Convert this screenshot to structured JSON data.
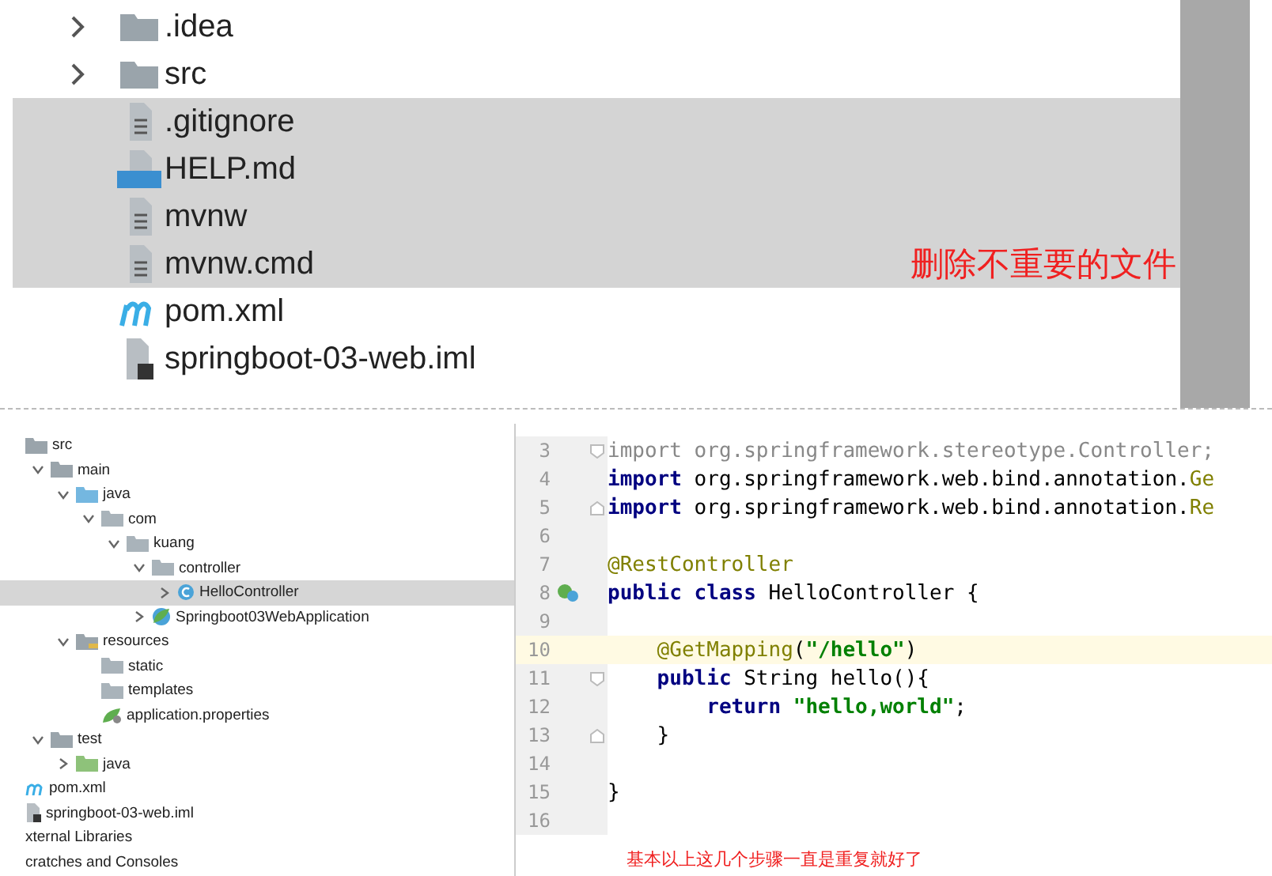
{
  "top_panel": {
    "files": [
      {
        "name": ".idea",
        "kind": "folder",
        "expanded": false,
        "selected": false
      },
      {
        "name": "src",
        "kind": "folder",
        "expanded": false,
        "selected": false
      },
      {
        "name": ".gitignore",
        "kind": "text-file",
        "selected": true
      },
      {
        "name": "HELP.md",
        "kind": "markdown",
        "selected": true
      },
      {
        "name": "mvnw",
        "kind": "text-file",
        "selected": true
      },
      {
        "name": "mvnw.cmd",
        "kind": "text-file",
        "selected": true
      },
      {
        "name": "pom.xml",
        "kind": "maven",
        "selected": false
      },
      {
        "name": "springboot-03-web.iml",
        "kind": "module-file",
        "selected": false
      }
    ],
    "note": "删除不重要的文件"
  },
  "project_tree": {
    "items": [
      {
        "name": "src",
        "kind": "folder",
        "selected": false,
        "children": [
          {
            "name": "main",
            "kind": "folder",
            "expanded": true,
            "selected": false,
            "children": [
              {
                "name": "java",
                "kind": "source-folder",
                "expanded": true,
                "selected": false,
                "children": [
                  {
                    "name": "com",
                    "kind": "package",
                    "expanded": true,
                    "selected": false,
                    "children": [
                      {
                        "name": "kuang",
                        "kind": "package",
                        "expanded": true,
                        "selected": false,
                        "children": [
                          {
                            "name": "controller",
                            "kind": "package",
                            "expanded": true,
                            "selected": false,
                            "children": [
                              {
                                "name": "HelloController",
                                "kind": "class",
                                "expanded": false,
                                "selected": true
                              }
                            ]
                          },
                          {
                            "name": "Springboot03WebApplication",
                            "kind": "spring-class",
                            "expanded": false,
                            "selected": false
                          }
                        ]
                      }
                    ]
                  }
                ]
              },
              {
                "name": "resources",
                "kind": "resources-folder",
                "expanded": true,
                "selected": false,
                "children": [
                  {
                    "name": "static",
                    "kind": "package",
                    "selected": false
                  },
                  {
                    "name": "templates",
                    "kind": "package",
                    "selected": false
                  },
                  {
                    "name": "application.properties",
                    "kind": "spring-config",
                    "selected": false
                  }
                ]
              }
            ]
          },
          {
            "name": "test",
            "kind": "folder",
            "expanded": true,
            "selected": false,
            "children": [
              {
                "name": "java",
                "kind": "test-folder",
                "expanded": false,
                "selected": false
              }
            ]
          }
        ]
      },
      {
        "name": "pom.xml",
        "kind": "maven",
        "selected": false
      },
      {
        "name": "springboot-03-web.iml",
        "kind": "module-file",
        "selected": false
      },
      {
        "name": "xternal Libraries",
        "kind": "plain",
        "selected": false
      },
      {
        "name": "cratches and Consoles",
        "kind": "plain",
        "selected": false
      }
    ]
  },
  "editor": {
    "lines": [
      {
        "number": "3",
        "current": false,
        "fold_start": true,
        "tokens": [
          {
            "kind": "muted",
            "text": "import org.springframework.stereotype.Controller;"
          }
        ]
      },
      {
        "number": "4",
        "current": false,
        "tokens": [
          {
            "kind": "keyword",
            "text": "import"
          },
          {
            "kind": "plain",
            "text": " org.springframework.web.bind.annotation."
          },
          {
            "kind": "annotation",
            "text": "Ge"
          }
        ]
      },
      {
        "number": "5",
        "current": false,
        "fold_end": true,
        "tokens": [
          {
            "kind": "keyword",
            "text": "import"
          },
          {
            "kind": "plain",
            "text": " org.springframework.web.bind.annotation."
          },
          {
            "kind": "annotation",
            "text": "Re"
          }
        ]
      },
      {
        "number": "6",
        "current": false
      },
      {
        "number": "7",
        "current": false,
        "tokens": [
          {
            "kind": "annotation",
            "text": "@RestController"
          }
        ]
      },
      {
        "number": "8",
        "current": false,
        "bean": true,
        "tokens": [
          {
            "kind": "keyword",
            "text": "public class"
          },
          {
            "kind": "plain",
            "text": " HelloController {"
          }
        ]
      },
      {
        "number": "9",
        "current": false
      },
      {
        "number": "10",
        "current": true,
        "tokens": [
          {
            "kind": "annotation",
            "text": "    @GetMapping"
          },
          {
            "kind": "plain",
            "text": "("
          },
          {
            "kind": "string",
            "text": "\"/hello\""
          },
          {
            "kind": "plain",
            "text": ")"
          }
        ]
      },
      {
        "number": "11",
        "current": false,
        "fold_start": true,
        "tokens": [
          {
            "kind": "keyword",
            "text": "    public"
          },
          {
            "kind": "plain",
            "text": " String hello(){"
          }
        ]
      },
      {
        "number": "12",
        "current": false,
        "tokens": [
          {
            "kind": "keyword",
            "text": "        return"
          },
          {
            "kind": "string",
            "text": " \"hello,world\""
          },
          {
            "kind": "plain",
            "text": ";"
          }
        ]
      },
      {
        "number": "13",
        "current": false,
        "fold_end": true,
        "tokens": [
          {
            "kind": "plain",
            "text": "    }"
          }
        ]
      },
      {
        "number": "14",
        "current": false
      },
      {
        "number": "15",
        "current": false,
        "tokens": [
          {
            "kind": "plain",
            "text": "}"
          }
        ]
      },
      {
        "number": "16",
        "current": false
      }
    ],
    "note": "基本以上这几个步骤一直是重复就好了"
  }
}
